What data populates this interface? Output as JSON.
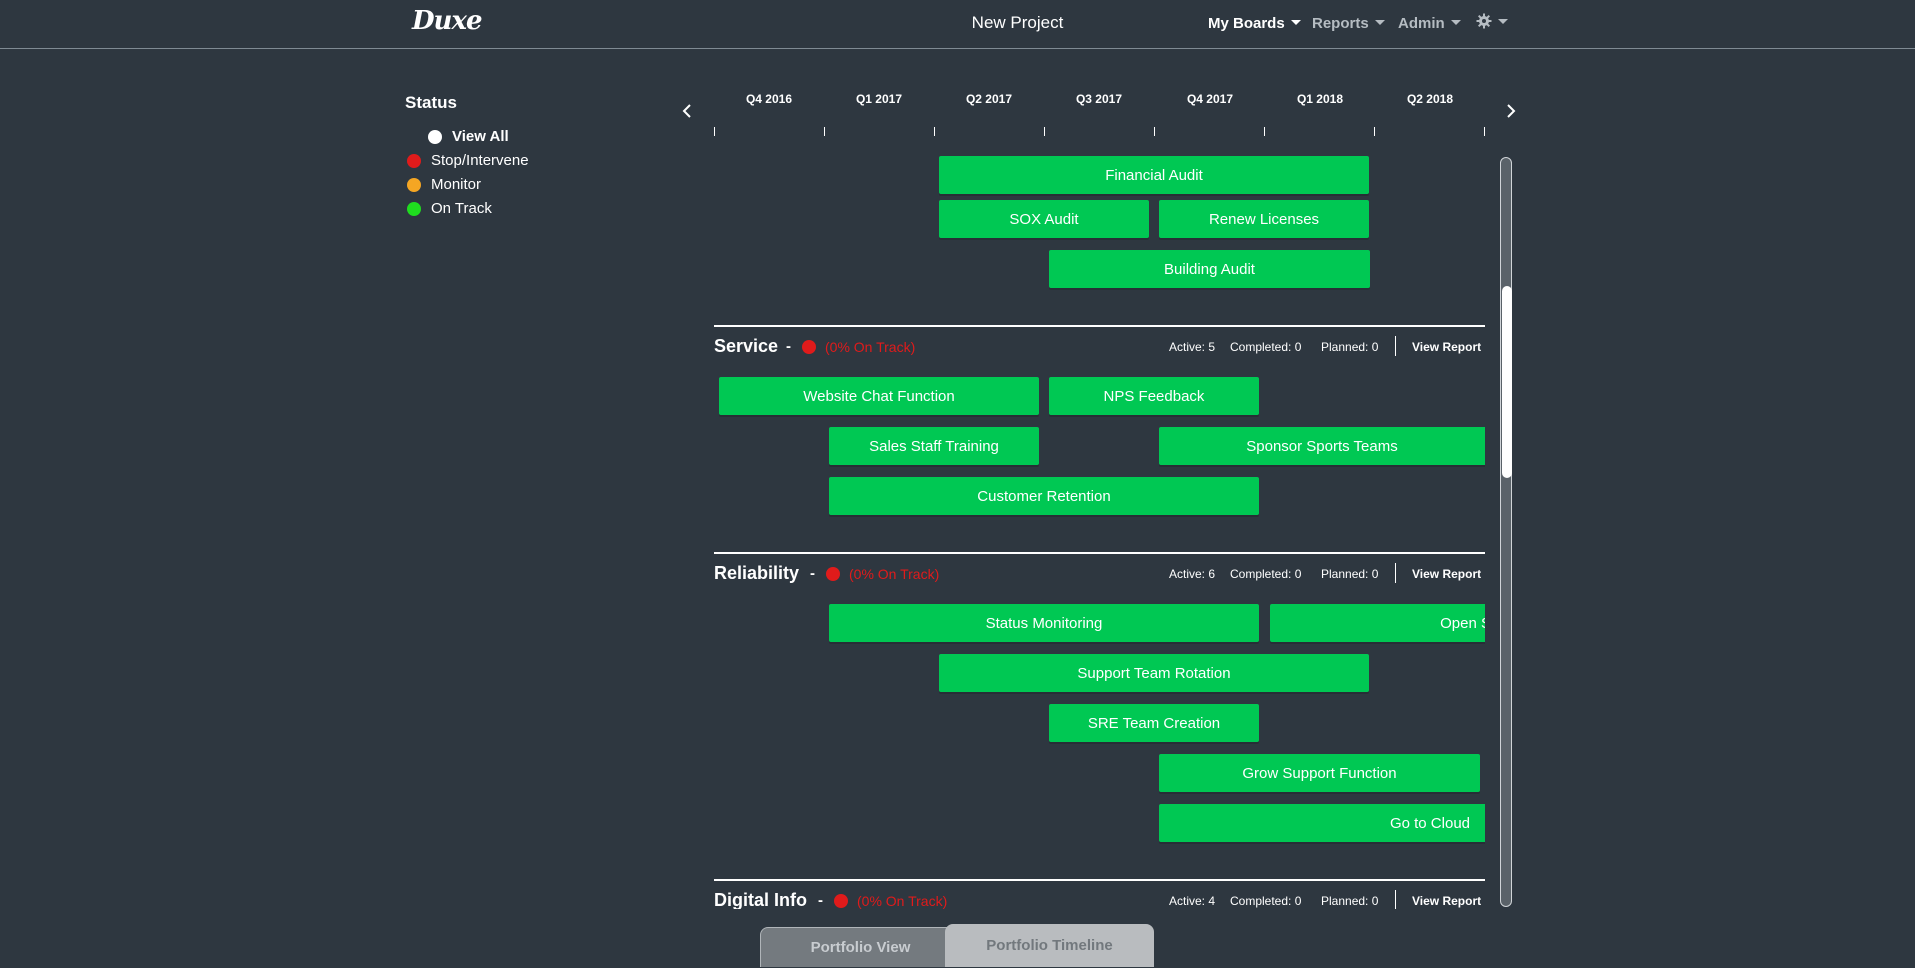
{
  "app": {
    "logo": "Duxe",
    "project_title": "New Project"
  },
  "nav": {
    "my_boards": "My Boards",
    "reports": "Reports",
    "admin": "Admin",
    "settings_icon": "gear-icon"
  },
  "status": {
    "title": "Status",
    "items": [
      {
        "label": "View All",
        "color": "#ffffff"
      },
      {
        "label": "Stop/Intervene",
        "color": "#e01b1b"
      },
      {
        "label": "Monitor",
        "color": "#f5a623"
      },
      {
        "label": "On Track",
        "color": "#1fdc1f"
      }
    ]
  },
  "timeline": {
    "prev_icon": "chevron-left-icon",
    "next_icon": "chevron-right-icon",
    "quarters": [
      "Q4 2016",
      "Q1 2017",
      "Q2 2017",
      "Q3 2017",
      "Q4 2017",
      "Q1 2018",
      "Q2 2018"
    ]
  },
  "top_bars": [
    "Financial Audit",
    "SOX Audit",
    "Renew Licenses",
    "Building Audit"
  ],
  "groups": [
    {
      "name": "Service",
      "sep": "-",
      "pct": "(0% On Track)",
      "active": "Active: 5",
      "completed": "Completed: 0",
      "planned": "Planned: 0",
      "view_report": "View Report",
      "bars": [
        "Website Chat Function",
        "NPS Feedback",
        "Sales Staff Training",
        "Sponsor Sports Teams",
        "Customer Retention"
      ]
    },
    {
      "name": "Reliability",
      "sep": "-",
      "pct": "(0% On Track)",
      "active": "Active: 6",
      "completed": "Completed: 0",
      "planned": "Planned: 0",
      "view_report": "View Report",
      "bars": [
        "Status Monitoring",
        "Open S",
        "Support Team Rotation",
        "SRE Team Creation",
        "Grow Support Function",
        "Go to Cloud"
      ]
    },
    {
      "name": "Digital Info",
      "sep": "-",
      "pct": "(0% On Track)",
      "active": "Active: 4",
      "completed": "Completed: 0",
      "planned": "Planned: 0",
      "view_report": "View Report"
    }
  ],
  "tabs": {
    "portfolio_view": "Portfolio View",
    "portfolio_timeline": "Portfolio Timeline"
  },
  "colors": {
    "background": "#2e3740",
    "bar": "#00c853",
    "stop": "#e01b1b"
  }
}
